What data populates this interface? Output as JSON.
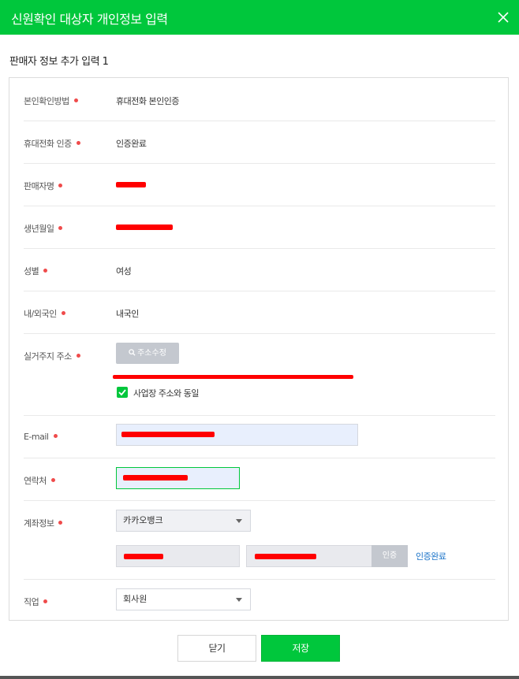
{
  "header": {
    "title": "신원확인 대상자 개인정보 입력",
    "close_icon": "close-icon"
  },
  "section_title": "판매자 정보 추가 입력 1",
  "colors": {
    "brand": "#00c73c",
    "required_dot": "#ef4b4b",
    "link": "#1a73c8",
    "redaction": "#ff0000"
  },
  "fields": {
    "auth_method": {
      "label": "본인확인방법",
      "value": "휴대전화 본인인증"
    },
    "phone_auth": {
      "label": "휴대전화 인증",
      "value": "인증완료"
    },
    "seller_name": {
      "label": "판매자명"
    },
    "birth_date": {
      "label": "생년월일"
    },
    "gender": {
      "label": "성별",
      "value": "여성"
    },
    "nationality": {
      "label": "내/외국인",
      "value": "내국인"
    },
    "address": {
      "label": "실거주지 주소",
      "edit_button": "주소수정",
      "same_as_business": "사업장 주소와 동일"
    },
    "email": {
      "label": "E-mail"
    },
    "contact": {
      "label": "연락처"
    },
    "account": {
      "label": "계좌정보",
      "bank_selected": "카카오뱅크",
      "verify_button": "인증",
      "verify_status": "인증완료"
    },
    "job": {
      "label": "직업",
      "selected": "회사원"
    }
  },
  "footer": {
    "close_label": "닫기",
    "save_label": "저장"
  }
}
